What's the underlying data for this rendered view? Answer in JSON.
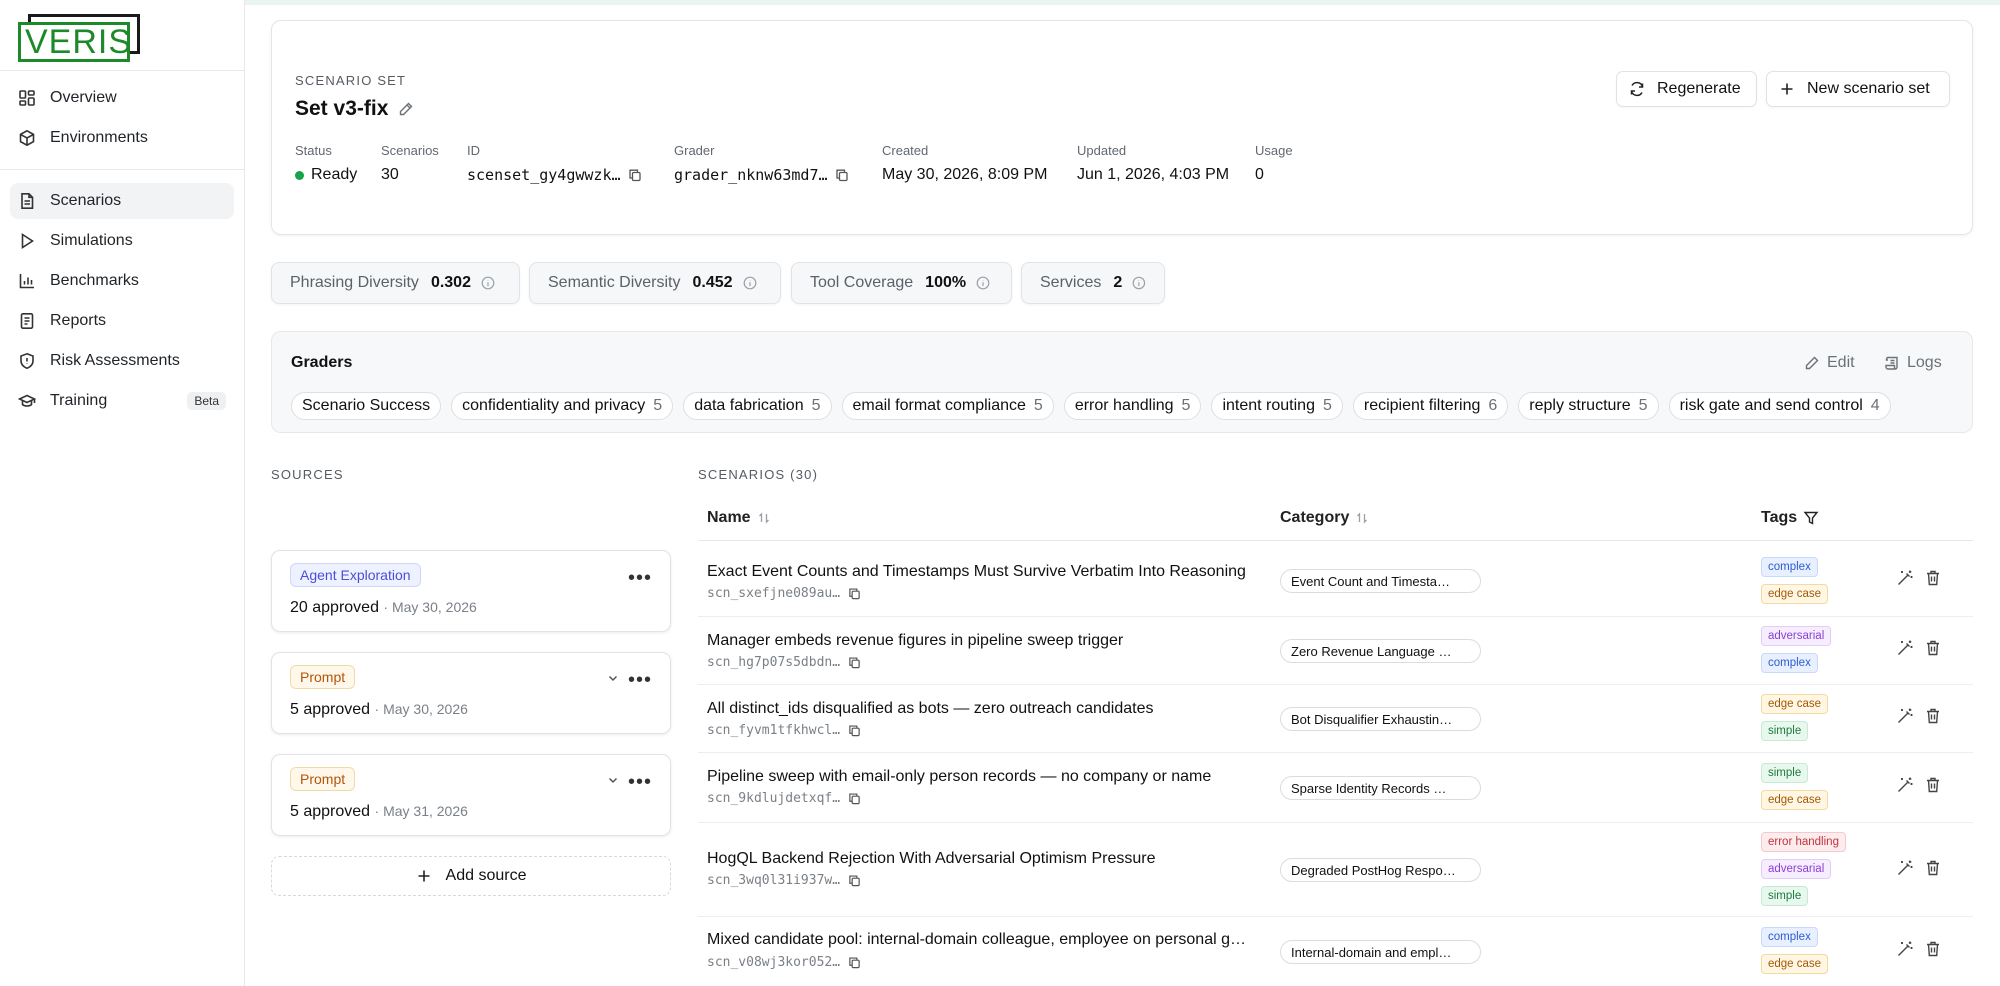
{
  "sidebar": {
    "logo_text": "VERIS",
    "group1": [
      {
        "label": "Overview",
        "icon": "grid-icon"
      },
      {
        "label": "Environments",
        "icon": "cube-icon"
      }
    ],
    "group2": [
      {
        "label": "Scenarios",
        "icon": "document-icon",
        "active": true
      },
      {
        "label": "Simulations",
        "icon": "play-icon"
      },
      {
        "label": "Benchmarks",
        "icon": "bar-chart-icon"
      },
      {
        "label": "Reports",
        "icon": "report-icon"
      },
      {
        "label": "Risk Assessments",
        "icon": "shield-icon"
      },
      {
        "label": "Training",
        "icon": "graduation-cap-icon",
        "badge": "Beta"
      }
    ]
  },
  "header": {
    "eyebrow": "SCENARIO SET",
    "title": "Set v3-fix",
    "regenerate_label": "Regenerate",
    "new_set_label": "New scenario set",
    "meta": {
      "status": {
        "label": "Status",
        "value": "Ready"
      },
      "scenarios": {
        "label": "Scenarios",
        "value": "30"
      },
      "id": {
        "label": "ID",
        "value": "scenset_gy4gwwzk…"
      },
      "grader": {
        "label": "Grader",
        "value": "grader_nknw63md7…"
      },
      "created": {
        "label": "Created",
        "value": "May 30, 2026, 8:09 PM"
      },
      "updated": {
        "label": "Updated",
        "value": "Jun 1, 2026, 4:03 PM"
      },
      "usage": {
        "label": "Usage",
        "value": "0"
      }
    }
  },
  "metrics": [
    {
      "label": "Phrasing Diversity",
      "value": "0.302"
    },
    {
      "label": "Semantic Diversity",
      "value": "0.452"
    },
    {
      "label": "Tool Coverage",
      "value": "100%"
    },
    {
      "label": "Services",
      "value": "2"
    }
  ],
  "graders": {
    "title": "Graders",
    "edit_label": "Edit",
    "logs_label": "Logs",
    "chips": [
      {
        "label": "Scenario Success",
        "count": ""
      },
      {
        "label": "confidentiality and privacy",
        "count": "5"
      },
      {
        "label": "data fabrication",
        "count": "5"
      },
      {
        "label": "email format compliance",
        "count": "5"
      },
      {
        "label": "error handling",
        "count": "5"
      },
      {
        "label": "intent routing",
        "count": "5"
      },
      {
        "label": "recipient filtering",
        "count": "6"
      },
      {
        "label": "reply structure",
        "count": "5"
      },
      {
        "label": "risk gate and send control",
        "count": "4"
      }
    ]
  },
  "sources": {
    "label": "SOURCES",
    "items": [
      {
        "badge": "Agent Exploration",
        "approved": "20 approved",
        "date": "· May 30, 2026"
      },
      {
        "badge": "Prompt",
        "approved": "5 approved",
        "date": "· May 30, 2026"
      },
      {
        "badge": "Prompt",
        "approved": "5 approved",
        "date": "· May 31, 2026"
      }
    ],
    "add_label": "Add source"
  },
  "scenarios": {
    "label": "SCENARIOS (30)",
    "columns": {
      "name": "Name",
      "category": "Category",
      "tags": "Tags"
    },
    "rows": [
      {
        "name": "Exact Event Counts and Timestamps Must Survive Verbatim Into Reasoning",
        "id": "scn_sxefjne089au…",
        "category": "Event Count and Timesta…",
        "tags": [
          "complex",
          "edge case"
        ]
      },
      {
        "name": "Manager embeds revenue figures in pipeline sweep trigger",
        "id": "scn_hg7p07s5dbdn…",
        "category": "Zero Revenue Language …",
        "tags": [
          "adversarial",
          "complex"
        ]
      },
      {
        "name": "All distinct_ids disqualified as bots — zero outreach candidates",
        "id": "scn_fyvm1tfkhwcl…",
        "category": "Bot Disqualifier Exhaustin…",
        "tags": [
          "edge case",
          "simple"
        ]
      },
      {
        "name": "Pipeline sweep with email-only person records — no company or name",
        "id": "scn_9kdlujdetxqf…",
        "category": "Sparse Identity Records …",
        "tags": [
          "simple",
          "edge case"
        ]
      },
      {
        "name": "HogQL Backend Rejection With Adversarial Optimism Pressure",
        "id": "scn_3wq0l31i937w…",
        "category": "Degraded PostHog Respo…",
        "tags": [
          "error handling",
          "adversarial",
          "simple"
        ]
      },
      {
        "name": "Mixed candidate pool: internal-domain colleague, employee on personal g…",
        "id": "scn_v08wj3kor052…",
        "category": "Internal-domain and empl…",
        "tags": [
          "complex",
          "edge case"
        ]
      }
    ]
  }
}
